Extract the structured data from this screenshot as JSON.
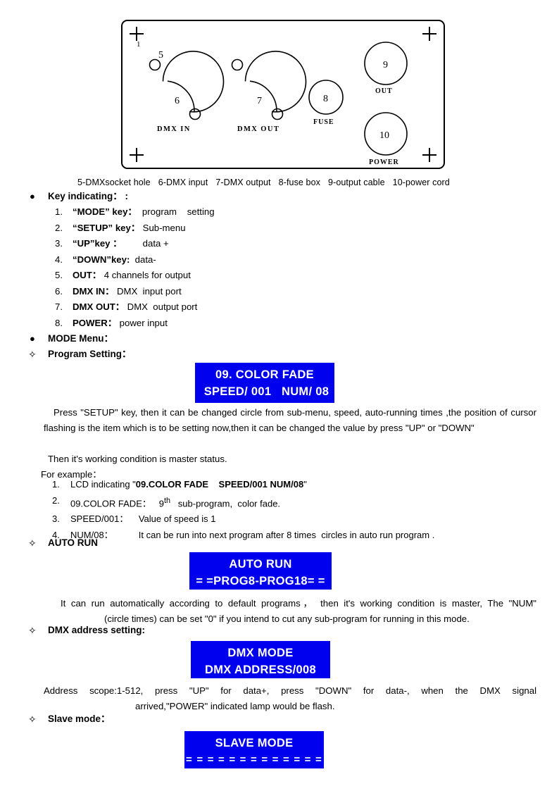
{
  "figure": {
    "name": "rear-panel-diagram",
    "corner_screw_label": "1",
    "callouts": [
      {
        "id": "5",
        "text": "5"
      },
      {
        "id": "6",
        "text": "6",
        "label": "DMX IN"
      },
      {
        "id": "7",
        "text": "7",
        "label": "DMX OUT"
      },
      {
        "id": "8",
        "text": "8",
        "label": "FUSE"
      },
      {
        "id": "9",
        "text": "9",
        "label": "OUT"
      },
      {
        "id": "10",
        "text": "10",
        "label": "POWER"
      }
    ],
    "caption_parts": [
      "5-DMXsocket  hole",
      "6-DMX  input",
      "7-DMX  output",
      "8-fuse box",
      "9-output cable",
      "10-power cord"
    ]
  },
  "sections": {
    "key_indicating": {
      "bullet": "●",
      "heading": "Key indicating： :",
      "items": [
        {
          "num": "1.",
          "bold": "“MODE” key：",
          "rest": "  program    setting"
        },
        {
          "num": "2.",
          "bold": "“SETUP” key：",
          "rest": " Sub-menu"
        },
        {
          "num": "3.",
          "bold": "“UP”key ：",
          "rest": "        data +"
        },
        {
          "num": "4.",
          "bold": "“DOWN”key:",
          "rest": "  data-"
        },
        {
          "num": "5.",
          "bold": "OUT：",
          "rest": " 4 channels for output"
        },
        {
          "num": "6.",
          "bold": "DMX IN：",
          "rest": " DMX  input port"
        },
        {
          "num": "7.",
          "bold": "DMX OUT：",
          "rest": " DMX  output port"
        },
        {
          "num": "8.",
          "bold": "POWER：",
          "rest": " power input"
        }
      ]
    },
    "mode_menu": {
      "bullet": "●",
      "heading": "MODE Menu："
    },
    "program_setting": {
      "bullet": "✧",
      "heading": "Program Setting：",
      "lcd": {
        "name": "lcd-program-setting",
        "line1": "09. COLOR FADE",
        "line2": " SPEED/ 001   NUM/ 08",
        "bg_color": "#0000EE",
        "text_color": "#FFFFFF"
      },
      "paragraph": "Press    \"SETUP\" key, then it can be changed    circle from sub-menu, speed, auto-running times ,the position of cursor flashing    is the item which is to be setting now,then it can be changed the value by press \"UP\" or \"DOWN\"",
      "master_note": "Then it's working condition is master status.",
      "for_example_label": "For example：",
      "example_items": [
        {
          "num": "1.",
          "pre": "LCD indicating \"",
          "bold": "09.COLOR FADE    SPEED/001 NUM/08",
          "post": "\""
        },
        {
          "num": "2.",
          "pre": "09.COLOR FADE：   9",
          "sup": "th",
          "post": "   sub-program,  color fade."
        },
        {
          "num": "3.",
          "pre": "SPEED/001：    Value of speed is 1",
          "post": ""
        },
        {
          "num": "4.",
          "pre": "NUM/08：          It can be run into next program after 8 times  circles in auto run program .",
          "post": ""
        }
      ]
    },
    "auto_run": {
      "bullet": "✧",
      "heading": "AUTO RUN",
      "lcd": {
        "name": "lcd-auto-run",
        "line1": "AUTO RUN",
        "line2": "= =PROG8-PROG18= =",
        "bg_color": "#0000EE",
        "text_color": "#FFFFFF"
      },
      "paragraph_line1": "It can run automatically according to default programs， then it's working condition is  master, The \"NUM\"",
      "paragraph_line2": "(circle times) can be set \"0\" if you intend to cut    any sub-program for running in this mode."
    },
    "dmx_address": {
      "bullet": "✧",
      "heading": "DMX address setting:",
      "lcd": {
        "name": "lcd-dmx-mode",
        "line1": "DMX MODE",
        "line2": "DMX ADDRESS/008",
        "bg_color": "#0000EE",
        "text_color": "#FFFFFF"
      },
      "paragraph_line1": "Address   scope:1-512, press  \"UP\"   for   data+, press  \"DOWN\"  for  data-,      when   the   DMX   signal",
      "paragraph_line2": "arrived,\"POWER\" indicated lamp would be flash."
    },
    "slave_mode": {
      "bullet": "✧",
      "heading": "Slave mode：",
      "lcd": {
        "name": "lcd-slave-mode",
        "line1": "SLAVE MODE",
        "line2": "= = = = = = = = = = = = =",
        "bg_color": "#0000EE",
        "text_color": "#FFFFFF"
      }
    }
  }
}
